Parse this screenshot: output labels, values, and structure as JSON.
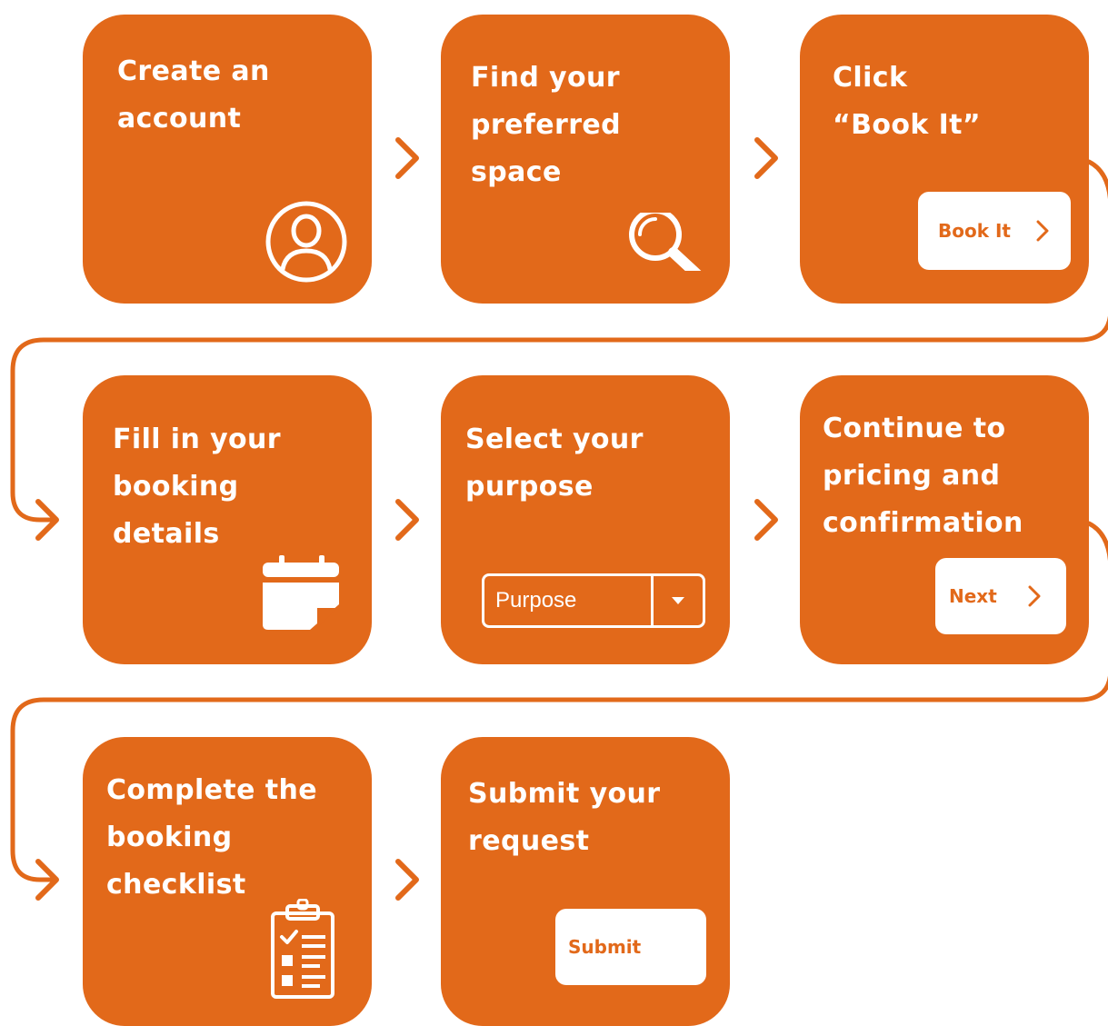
{
  "colors": {
    "accent": "#e2691a",
    "text_on_accent": "#ffffff",
    "button_bg": "#ffffff"
  },
  "steps": [
    {
      "title": "Create an\naccount",
      "icon": "user-circle-icon"
    },
    {
      "title": "Find your\npreferred\nspace",
      "icon": "magnifier-icon"
    },
    {
      "title": "Click\n“Book It”",
      "button_label": "Book It"
    },
    {
      "title": "Fill in your\nbooking\ndetails",
      "icon": "calendar-icon"
    },
    {
      "title": "Select your\npurpose",
      "select_value": "Purpose"
    },
    {
      "title": "Continue to\npricing and\nconfirmation",
      "button_label": "Next"
    },
    {
      "title": "Complete the\nbooking\nchecklist",
      "icon": "clipboard-checklist-icon"
    },
    {
      "title": "Submit your\nrequest",
      "button_label": "Submit"
    }
  ]
}
